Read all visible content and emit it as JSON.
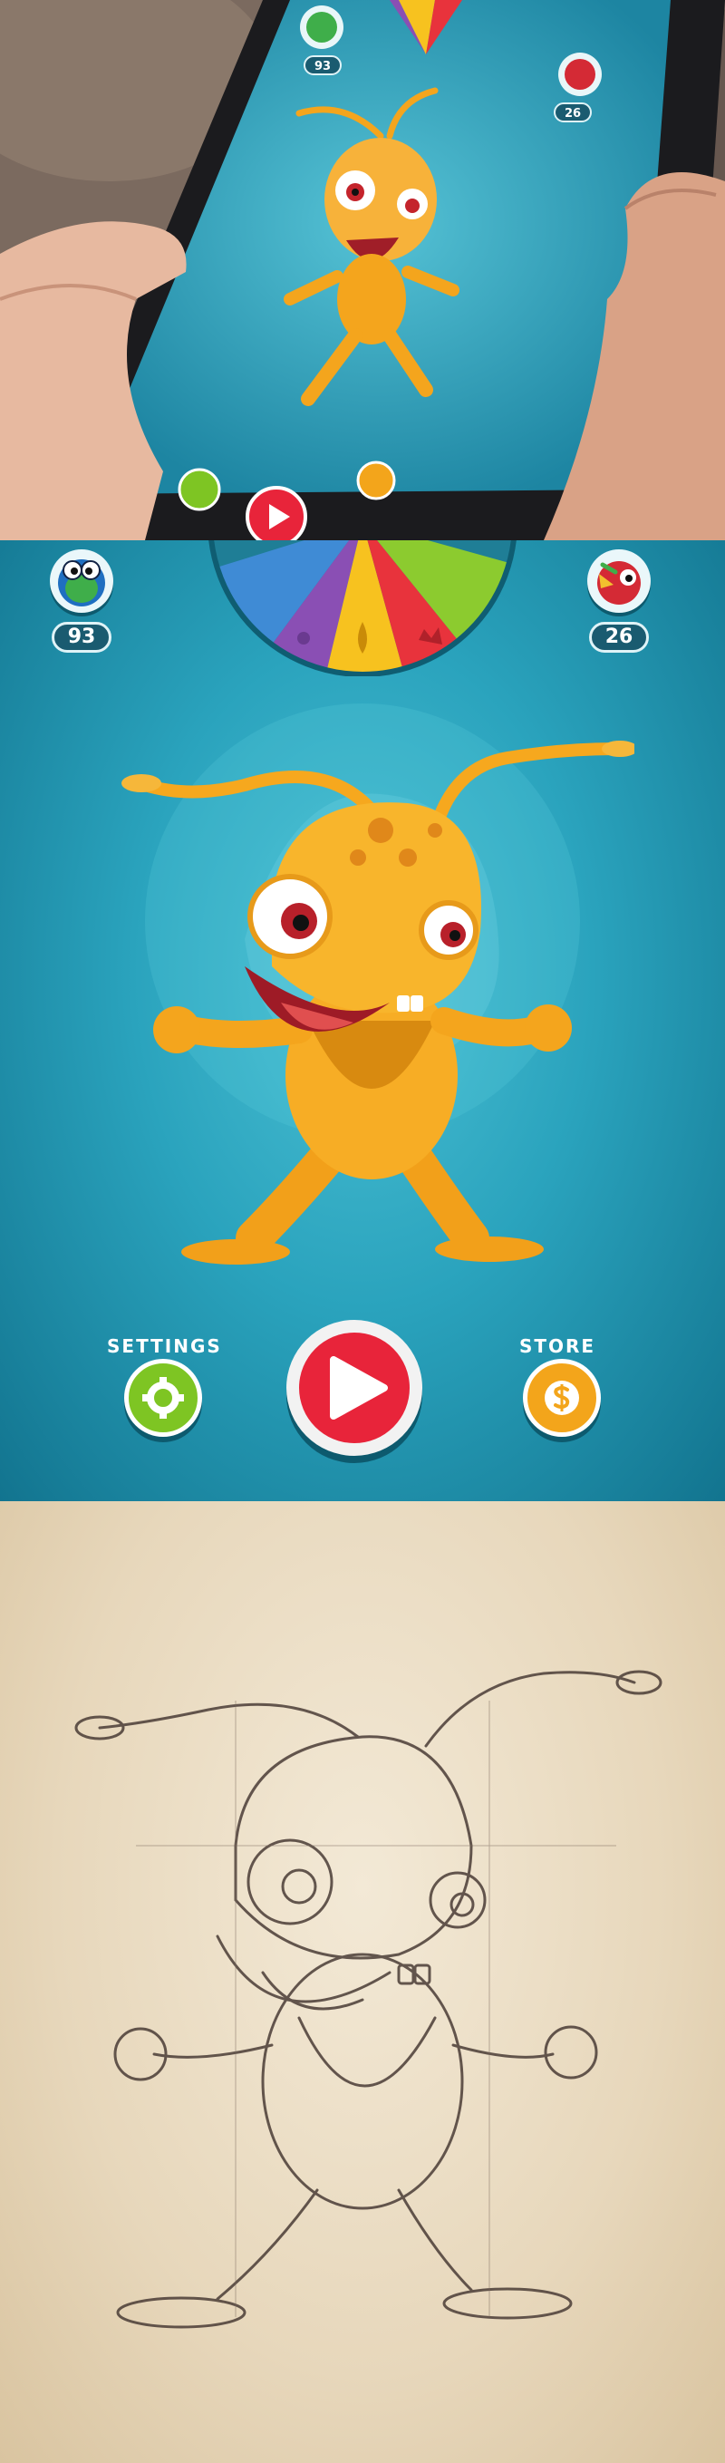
{
  "hud": {
    "left_counter": "93",
    "right_counter": "26"
  },
  "buttons": {
    "settings_label": "SETTINGS",
    "store_label": "STORE"
  },
  "icons": {
    "left_avatar": "green-bug-icon",
    "right_avatar": "red-bird-icon",
    "settings": "gear-icon",
    "store": "dollar-icon",
    "play": "play-icon",
    "wheel": "spin-wheel"
  },
  "colors": {
    "background": "#2aa3bd",
    "settings_button": "#7ec523",
    "play_button": "#e8243a",
    "store_button": "#f3a51b",
    "wheel_yellow": "#f7c21f",
    "wheel_red": "#e8333c",
    "wheel_green": "#8ccb2f",
    "wheel_purple": "#8a4fb4",
    "wheel_blue": "#3f8bd5",
    "character": "#f4a51d"
  }
}
